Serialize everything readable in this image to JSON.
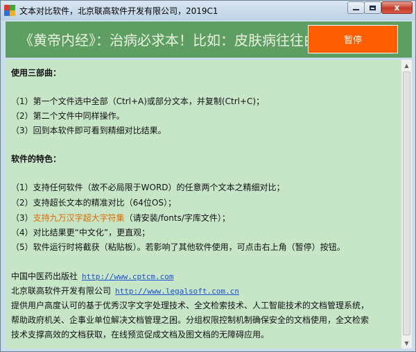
{
  "window": {
    "title": "文本对比软件，北京联高软件开发有限公司，2019C1",
    "close_label": "x"
  },
  "marquee": {
    "text": "《黄帝内经》：治病必求本！比如：皮肤病往往由",
    "pause_label": "暂停"
  },
  "content": {
    "section1_heading": "使用三部曲：",
    "steps": [
      "（1）第一个文件选中全部（Ctrl+A)或部分文本，并复制(Ctrl+C)；",
      "（2）第二个文件中同样操作。",
      "（3）回到本软件即可看到精细对比结果。"
    ],
    "section2_heading": "软件的特色：",
    "features": {
      "f1": "（1）支持任何软件（故不必局限于WORD）的任意两个文本之精细对比；",
      "f2": "（2）支持超长文本的精准对比（64位OS）；",
      "f3_prefix": "（3）",
      "f3_highlight": "支持九万汉字超大字符集",
      "f3_suffix": "（请安装/fonts/字库文件）；",
      "f4": "（4）对比结果更“中文化”，更直观；",
      "f5": "（5）软件运行时将截获（粘贴板）。若影响了其他软件使用，可点击右上角（暂停）按钮。"
    },
    "publisher1_name": "中国中医药出版社",
    "publisher1_url": "http://www.cptcm.com",
    "publisher2_name": "北京联高软件开发有限公司",
    "publisher2_url": "http://www.legalsoft.com.cn",
    "desc_lines": [
      "提供用户高度认可的基于优秀汉字文字处理技术、全文检索技术、人工智能技术的文档管理系统，",
      "帮助政府机关、企事业单位解决文档管理之困。分组权限控制机制确保安全的文档使用，全文检索",
      "技术支撑高效的文档获取，在线预览促成文档及图文档的无障碍应用。"
    ]
  },
  "colors": {
    "marquee_bg": "#5f9e63",
    "content_bg": "#c7e6c8",
    "pause_button": "#ff5d00",
    "highlight": "#e26a00",
    "link": "#1a4fd0"
  }
}
